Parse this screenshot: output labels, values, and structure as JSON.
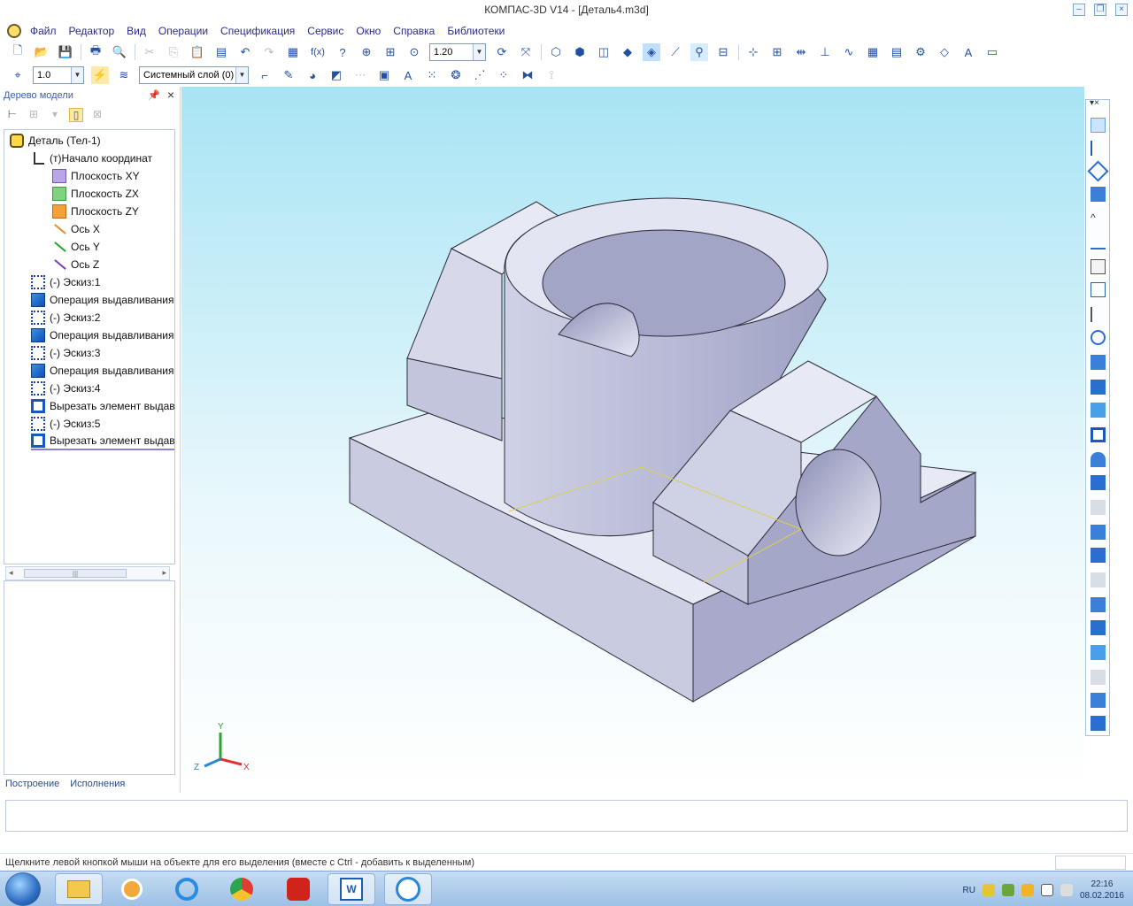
{
  "window": {
    "title": "КОМПАС-3D V14 - [Деталь4.m3d]"
  },
  "menu": [
    "Файл",
    "Редактор",
    "Вид",
    "Операции",
    "Спецификация",
    "Сервис",
    "Окно",
    "Справка",
    "Библиотеки"
  ],
  "toolbar1": {
    "zoom_value": "1.20",
    "fx_label": "f(x)"
  },
  "toolbar2": {
    "step_value": "1.0",
    "layer_label": "Системный слой (0)"
  },
  "left_panel": {
    "title": "Дерево модели",
    "tree": [
      {
        "label": "Деталь (Тел-1)",
        "icon": "part-icon",
        "indent": 0
      },
      {
        "label": "(т)Начало координат",
        "icon": "origin-icon",
        "indent": 1
      },
      {
        "label": "Плоскость XY",
        "icon": "plane-xy-icon",
        "indent": 2
      },
      {
        "label": "Плоскость ZX",
        "icon": "plane-zx-icon",
        "indent": 2
      },
      {
        "label": "Плоскость ZY",
        "icon": "plane-zy-icon",
        "indent": 2
      },
      {
        "label": "Ось X",
        "icon": "axis-x-icon",
        "indent": 2
      },
      {
        "label": "Ось Y",
        "icon": "axis-y-icon",
        "indent": 2
      },
      {
        "label": "Ось Z",
        "icon": "axis-z-icon",
        "indent": 2
      },
      {
        "label": "(-) Эскиз:1",
        "icon": "sketch-icon",
        "indent": 1
      },
      {
        "label": "Операция выдавливания",
        "icon": "extrude-icon",
        "indent": 1
      },
      {
        "label": "(-) Эскиз:2",
        "icon": "sketch-icon",
        "indent": 1
      },
      {
        "label": "Операция выдавливания",
        "icon": "extrude-icon",
        "indent": 1
      },
      {
        "label": "(-) Эскиз:3",
        "icon": "sketch-icon",
        "indent": 1
      },
      {
        "label": "Операция выдавливания",
        "icon": "extrude-icon",
        "indent": 1
      },
      {
        "label": "(-) Эскиз:4",
        "icon": "sketch-icon",
        "indent": 1
      },
      {
        "label": "Вырезать элемент выдав.",
        "icon": "cut-extrude-icon",
        "indent": 1
      },
      {
        "label": "(-) Эскиз:5",
        "icon": "sketch-icon",
        "indent": 1
      },
      {
        "label": "Вырезать элемент выдав.",
        "icon": "cut-extrude-icon",
        "indent": 1
      }
    ],
    "tabs": [
      "Построение",
      "Исполнения"
    ]
  },
  "viewport": {
    "axis_labels": {
      "x": "X",
      "y": "Y",
      "z": "Z"
    },
    "colors": {
      "part_face_top": "#e7e9f4",
      "part_face_left": "#c9cbe0",
      "part_face_right": "#a9aacb",
      "edge": "#2a2a3a",
      "sketch_line": "#d9d24a"
    }
  },
  "status": {
    "hint": "Щелкните левой кнопкой мыши на объекте для его выделения (вместе с Ctrl - добавить к выделенным)"
  },
  "taskbar": {
    "apps": [
      "explorer-icon",
      "media-player-icon",
      "ie-icon",
      "chrome-icon",
      "acrobat-icon",
      "word-icon",
      "kompas-icon"
    ],
    "clock_time": "22:16",
    "clock_date": "08.02.2016",
    "lang": "RU"
  }
}
